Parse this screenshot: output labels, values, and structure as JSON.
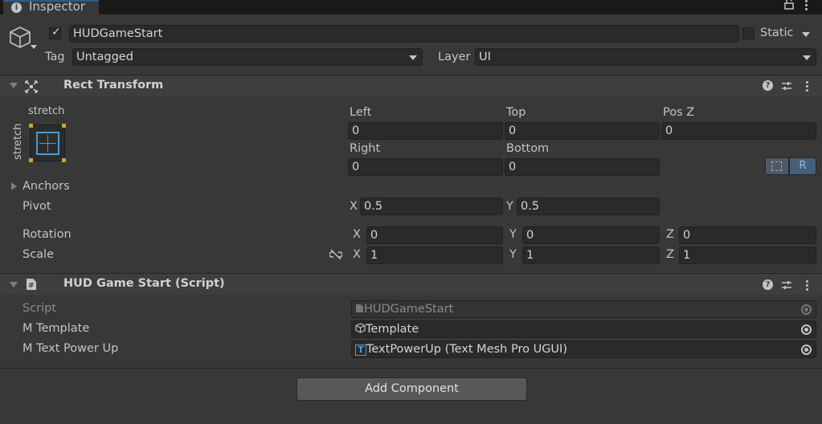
{
  "window": {
    "tab_label": "Inspector",
    "tab_icon": "info-icon"
  },
  "gameobject": {
    "active": true,
    "name": "HUDGameStart",
    "static_label": "Static",
    "tag_label": "Tag",
    "tag_value": "Untagged",
    "layer_label": "Layer",
    "layer_value": "UI"
  },
  "rect_transform": {
    "title": "Rect Transform",
    "anchor_preset_top": "stretch",
    "anchor_preset_side": "stretch",
    "left_label": "Left",
    "left_value": "0",
    "top_label": "Top",
    "top_value": "0",
    "posz_label": "Pos Z",
    "posz_value": "0",
    "right_label": "Right",
    "right_value": "0",
    "bottom_label": "Bottom",
    "bottom_value": "0",
    "blueprint_btn": "",
    "raw_btn": "R",
    "anchors_label": "Anchors",
    "pivot_label": "Pivot",
    "pivot_x_label": "X",
    "pivot_x": "0.5",
    "pivot_y_label": "Y",
    "pivot_y": "0.5",
    "rotation_label": "Rotation",
    "rot_x_label": "X",
    "rot_x": "0",
    "rot_y_label": "Y",
    "rot_y": "0",
    "rot_z_label": "Z",
    "rot_z": "0",
    "scale_label": "Scale",
    "scale_x_label": "X",
    "scale_x": "1",
    "scale_y_label": "Y",
    "scale_y": "1",
    "scale_z_label": "Z",
    "scale_z": "1"
  },
  "script_component": {
    "title": "HUD Game Start (Script)",
    "script_label": "Script",
    "script_value": "HUDGameStart",
    "template_label": "M Template",
    "template_value": "Template",
    "power_label": "M Text Power Up",
    "power_value": "TextPowerUp (Text Mesh Pro UGUI)"
  },
  "add_component_label": "Add Component",
  "colors": {
    "background": "#383838",
    "field": "#2a2a2a",
    "accent": "#4a9ad8"
  }
}
